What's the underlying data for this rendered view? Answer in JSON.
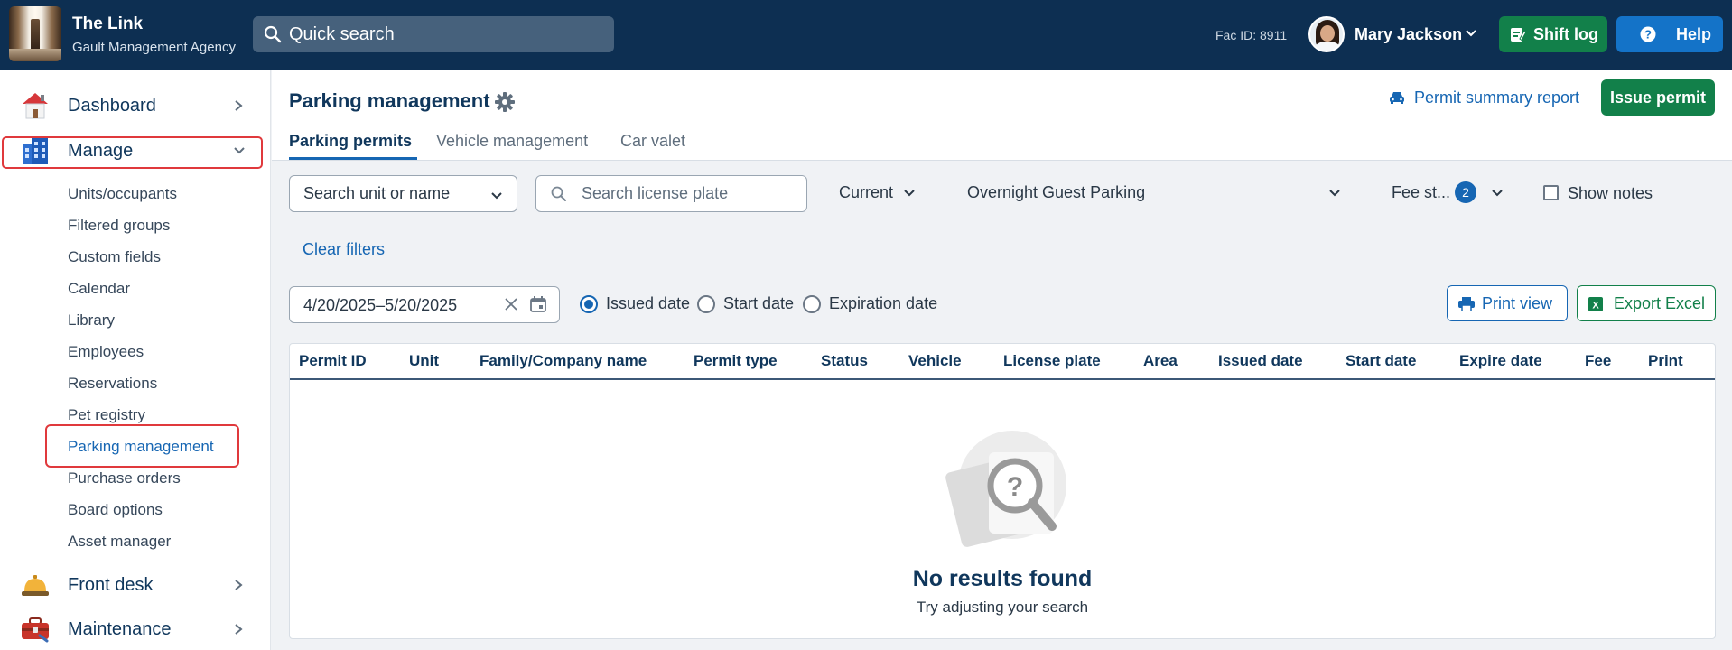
{
  "header": {
    "brand_title": "The Link",
    "brand_subtitle": "Gault Management Agency",
    "search_placeholder": "Quick search",
    "fac_id": "Fac ID: 8911",
    "user_name": "Mary Jackson",
    "shift_log_label": "Shift log",
    "help_label": "Help"
  },
  "sidebar": {
    "main_items": [
      {
        "label": "Dashboard",
        "icon": "house-icon"
      },
      {
        "label": "Manage",
        "icon": "building-icon",
        "expanded": true
      },
      {
        "label": "Front desk",
        "icon": "desk-bell-icon"
      },
      {
        "label": "Maintenance",
        "icon": "toolbox-icon"
      }
    ],
    "manage_items": [
      "Units/occupants",
      "Filtered groups",
      "Custom fields",
      "Calendar",
      "Library",
      "Employees",
      "Reservations",
      "Pet registry",
      "Parking management",
      "Purchase orders",
      "Board options",
      "Asset manager"
    ],
    "active_item": "Parking management"
  },
  "page": {
    "title": "Parking management",
    "permit_summary_label": "Permit summary report",
    "issue_permit_label": "Issue permit",
    "tabs": [
      "Parking permits",
      "Vehicle management",
      "Car valet"
    ],
    "active_tab": "Parking permits"
  },
  "filters": {
    "unit_search_placeholder": "Search unit or name",
    "plate_search_placeholder": "Search license plate",
    "status_value": "Current",
    "area_value": "Overnight Guest Parking",
    "fee_status_label": "Fee st...",
    "fee_status_count": "2",
    "show_notes_label": "Show notes",
    "show_notes_checked": false,
    "clear_filters_label": "Clear filters",
    "date_range": "4/20/2025–5/20/2025",
    "date_type_options": [
      "Issued date",
      "Start date",
      "Expiration date"
    ],
    "date_type_selected": "Issued date",
    "print_view_label": "Print view",
    "export_excel_label": "Export Excel"
  },
  "table": {
    "columns": [
      "Permit ID",
      "Unit",
      "Family/Company name",
      "Permit type",
      "Status",
      "Vehicle",
      "License plate",
      "Area",
      "Issued date",
      "Start date",
      "Expire date",
      "Fee",
      "Print"
    ],
    "rows": [],
    "empty_title": "No results found",
    "empty_subtitle": "Try adjusting your search"
  },
  "colors": {
    "topbar": "#0d2f52",
    "primary_blue": "#1666b3",
    "success_green": "#12804a",
    "highlight_red": "#e0393c"
  }
}
